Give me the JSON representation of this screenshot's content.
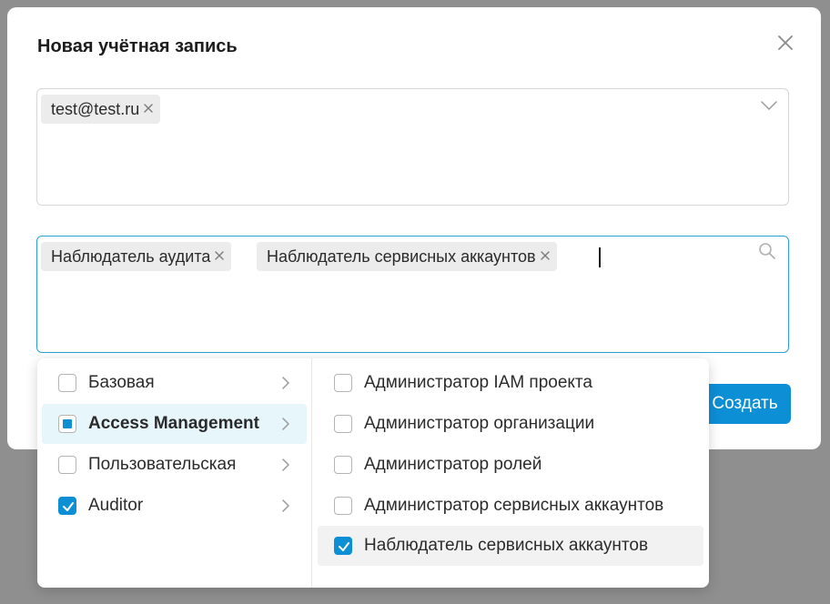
{
  "modal": {
    "title": "Новая учётная запись",
    "create_label": "Создать"
  },
  "email_field": {
    "chips": [
      {
        "label": "test@test.ru"
      }
    ]
  },
  "roles_field": {
    "chips": [
      {
        "label": "Наблюдатель аудита"
      },
      {
        "label": "Наблюдатель сервисных аккаунтов"
      }
    ]
  },
  "dropdown": {
    "categories": [
      {
        "label": "Базовая",
        "state": "unchecked"
      },
      {
        "label": "Access Management",
        "state": "indeterminate"
      },
      {
        "label": "Пользовательская",
        "state": "unchecked"
      },
      {
        "label": "Auditor",
        "state": "checked"
      }
    ],
    "roles": [
      {
        "label": "Администратор IAM проекта",
        "checked": false
      },
      {
        "label": "Администратор организации",
        "checked": false
      },
      {
        "label": "Администратор ролей",
        "checked": false
      },
      {
        "label": "Администратор сервисных аккаунтов",
        "checked": false
      },
      {
        "label": "Наблюдатель сервисных аккаунтов",
        "checked": true
      }
    ]
  },
  "colors": {
    "accent": "#0d8fd6",
    "focus_border": "#2aa0d8",
    "highlight_bg": "#e6f6fb",
    "overlay": "#8f8f8f"
  },
  "icons": {
    "close": "close-icon",
    "dropdown": "chevron-down-icon",
    "search": "search-icon",
    "chip_remove": "remove-icon",
    "submenu": "chevron-right-icon",
    "check": "checkmark-icon"
  }
}
